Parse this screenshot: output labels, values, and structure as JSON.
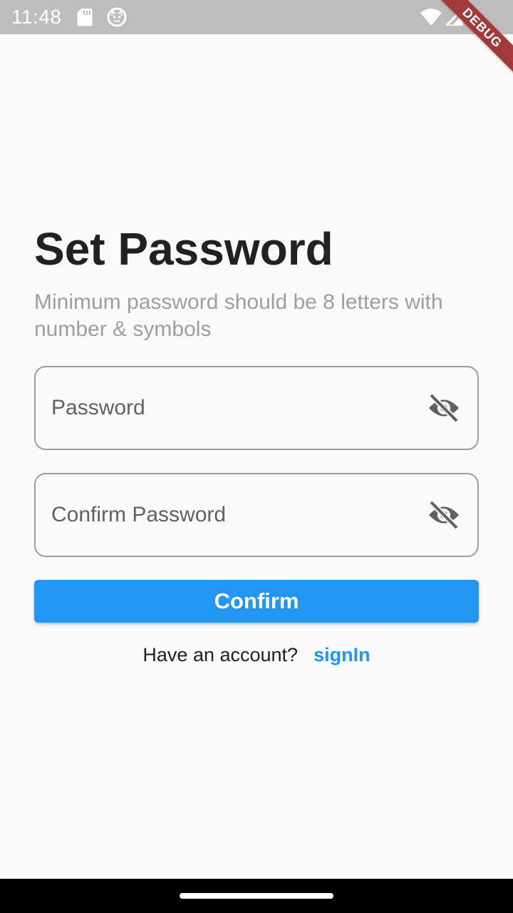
{
  "status_bar": {
    "time": "11:48",
    "debug_label": "DEBUG"
  },
  "screen": {
    "title": "Set Password",
    "subtitle": "Minimum password should be 8 letters with number & symbols"
  },
  "form": {
    "password": {
      "placeholder": "Password",
      "value": ""
    },
    "confirm_password": {
      "placeholder": "Confirm Password",
      "value": ""
    },
    "visibility_icon": "eye-off-icon"
  },
  "actions": {
    "confirm_label": "Confirm",
    "signin_prompt": "Have an account?",
    "signin_link": "signIn"
  },
  "colors": {
    "accent": "#2196f3",
    "status_bar": "#bdbdbd",
    "debug_ribbon": "#a33a3a",
    "title_text": "#212121",
    "subtitle_text": "#9e9e9e",
    "field_border": "#9e9e9e"
  }
}
